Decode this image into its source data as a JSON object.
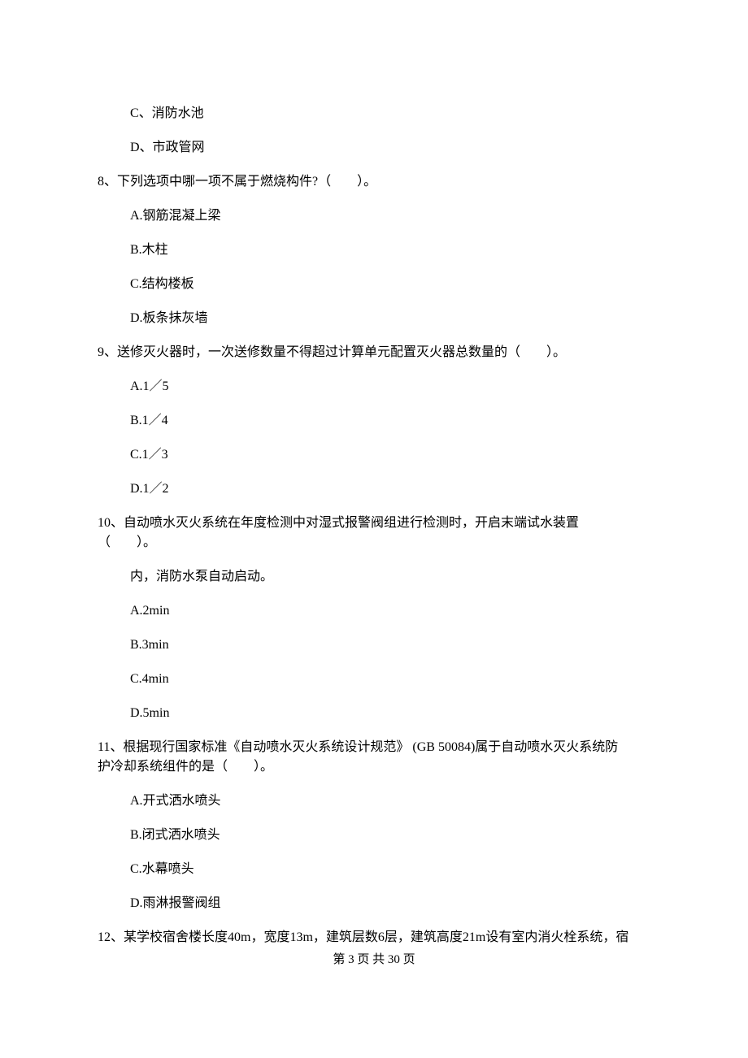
{
  "q7_options": {
    "c": "C、消防水池",
    "d": "D、市政管网"
  },
  "q8": {
    "stem": "8、下列选项中哪一项不属于燃烧构件?（　　）。",
    "a": "A.钢筋混凝上梁",
    "b": "B.木柱",
    "c": "C.结构楼板",
    "d": "D.板条抹灰墙"
  },
  "q9": {
    "stem": "9、送修灭火器时，一次送修数量不得超过计算单元配置灭火器总数量的（　　）。",
    "a": "A.1／5",
    "b": "B.1／4",
    "c": "C.1／3",
    "d": "D.1／2"
  },
  "q10": {
    "stem_line1": "10、自动喷水灭火系统在年度检测中对湿式报警阀组进行检测时，开启末端试水装置",
    "stem_line2": "（　　）。",
    "sub": "内，消防水泵自动启动。",
    "a": "A.2min",
    "b": "B.3min",
    "c": "C.4min",
    "d": "D.5min"
  },
  "q11": {
    "stem_line1": "11、根据现行国家标准《自动喷水灭火系统设计规范》 (GB 50084)属于自动喷水灭火系统防",
    "stem_line2": "护冷却系统组件的是（　　）。",
    "a": "A.开式洒水喷头",
    "b": "B.闭式洒水喷头",
    "c": "C.水幕喷头",
    "d": "D.雨淋报警阀组"
  },
  "q12": {
    "stem": "12、某学校宿舍楼长度40m，宽度13m，建筑层数6层，建筑高度21m设有室内消火栓系统，宿"
  },
  "footer": "第 3 页 共 30 页"
}
